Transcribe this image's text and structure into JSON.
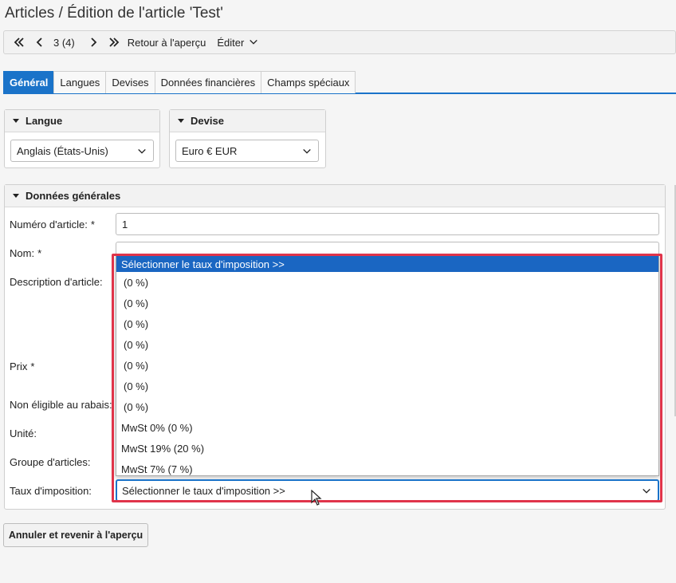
{
  "page": {
    "title": "Articles / Édition de l'article 'Test'"
  },
  "toolbar": {
    "record_position": "3 (4)",
    "back_to_overview": "Retour à l'aperçu",
    "edit_label": "Éditer"
  },
  "tabs": [
    {
      "label": "Général",
      "active": true
    },
    {
      "label": "Langues",
      "active": false
    },
    {
      "label": "Devises",
      "active": false
    },
    {
      "label": "Données financières",
      "active": false
    },
    {
      "label": "Champs spéciaux",
      "active": false
    }
  ],
  "language_panel": {
    "title": "Langue",
    "selected": "Anglais (États-Unis)"
  },
  "currency_panel": {
    "title": "Devise",
    "selected": "Euro € EUR"
  },
  "general_panel": {
    "title": "Données générales",
    "fields": {
      "article_number_label": "Numéro d'article:",
      "article_number_value": "1",
      "name_label": "Nom:",
      "description_label": "Description d'article:",
      "price_label": "Prix",
      "discount_label": "Non éligible au rabais:",
      "unit_label": "Unité:",
      "group_label": "Groupe d'articles:",
      "tax_label": "Taux d'imposition:"
    },
    "required_marker": "*"
  },
  "tax_dropdown": {
    "selected": "Sélectionner le taux d'imposition >>",
    "options": [
      "Sélectionner le taux d'imposition >>",
      "(0 %)",
      "(0 %)",
      "(0 %)",
      "(0 %)",
      "(0 %)",
      "(0 %)",
      "(0 %)",
      "MwSt 0% (0 %)",
      "MwSt 19% (20 %)",
      "MwSt 7% (7 %)"
    ]
  },
  "footer": {
    "cancel_label": "Annuler et revenir à l'aperçu"
  },
  "colors": {
    "accent": "#1a73c9",
    "highlight": "#1a66c2",
    "annotation_frame": "#e0344a"
  }
}
